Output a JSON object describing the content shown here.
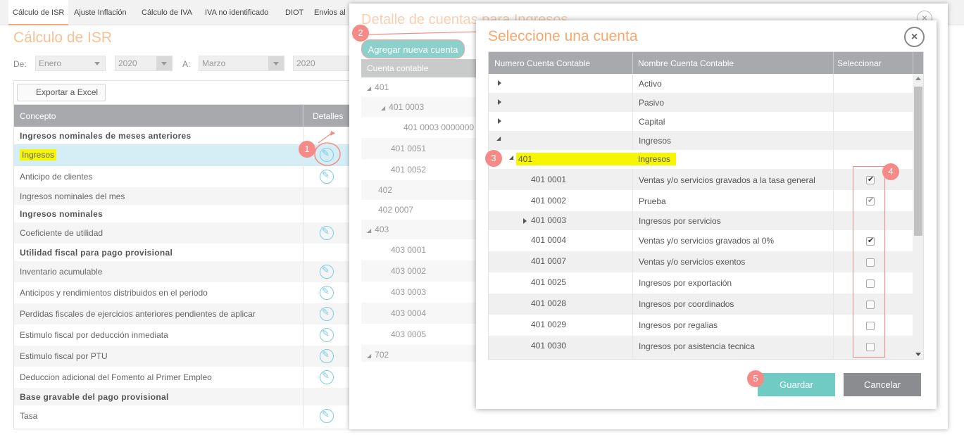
{
  "tabs": [
    "Cálculo de ISR",
    "Ajuste Inflación",
    "Cálculo de IVA",
    "IVA no identificado",
    "DIOT",
    "Envios al"
  ],
  "main": {
    "title": "Cálculo de ISR",
    "filters": {
      "de_label": "De:",
      "de_month": "Enero",
      "de_year": "2020",
      "a_label": "A:",
      "a_month": "Marzo",
      "a_year": "2020"
    },
    "export_label": "Exportar a Excel",
    "columns": [
      "Concepto",
      "Detalles"
    ],
    "rows": [
      "Ingresos nominales de meses anteriores",
      "Ingresos",
      "Anticipo de clientes",
      "Ingresos nominales del mes",
      "Ingresos nominales",
      "Coeficiente de utilidad",
      "Utilidad fiscal para pago provisional",
      "Inventario acumulable",
      "Anticipos y rendimientos distribuidos en el periodo",
      "Perdidas fiscales de ejercicios anteriores pendientes de aplicar",
      "Estimulo fiscal por deducción inmediata",
      "Estimulo fiscal por PTU",
      "Deduccion adicional del Fomento al Primer Empleo",
      "Base gravable del pago provisional",
      "Tasa"
    ]
  },
  "detail_modal": {
    "title": "Detalle de cuentas para Ingresos",
    "add_button": "Agregar nueva cuenta",
    "tree_header": "Cuenta contable",
    "tree": [
      "401",
      "401 0003",
      "401 0003 0000000",
      "401 0051",
      "401 0052",
      "402",
      "402 0007",
      "403",
      "403 0001",
      "403 0002",
      "403 0003",
      "403 0004",
      "403 0005",
      "702"
    ]
  },
  "select_modal": {
    "title": "Seleccione una cuenta",
    "close_icon": "×",
    "columns": [
      "Numero Cuenta Contable",
      "Nombre Cuenta Contable",
      "Seleccionar"
    ],
    "groups": [
      "Activo",
      "Pasivo",
      "Capital",
      "Ingresos"
    ],
    "parent": {
      "number": "401",
      "name": "Ingresos"
    },
    "accounts": [
      {
        "number": "401 0001",
        "name": "Ventas y/o servicios gravados a la tasa general",
        "selected": true
      },
      {
        "number": "401 0002",
        "name": "Prueba",
        "selected": true
      },
      {
        "number": "401 0003",
        "name": "Ingresos por servicios",
        "selected": false
      },
      {
        "number": "401 0004",
        "name": "Ventas y/o servicios gravados al 0%",
        "selected": true
      },
      {
        "number": "401 0007",
        "name": "Ventas y/o servicios exentos",
        "selected": false
      },
      {
        "number": "401 0025",
        "name": "Ingresos por exportación",
        "selected": false
      },
      {
        "number": "401 0028",
        "name": "Ingresos por coordinados",
        "selected": false
      },
      {
        "number": "401 0029",
        "name": "Ingresos por regalias",
        "selected": false
      },
      {
        "number": "401 0030",
        "name": "Ingresos por asistencia tecnica",
        "selected": false
      }
    ],
    "save_label": "Guardar",
    "cancel_label": "Cancelar"
  },
  "badges": [
    "1",
    "2",
    "3",
    "4",
    "5"
  ],
  "colors": {
    "accent": "#f6a86d",
    "badge": "#f58a86",
    "save": "#6fcbc3",
    "highlight": "#f6f600"
  }
}
